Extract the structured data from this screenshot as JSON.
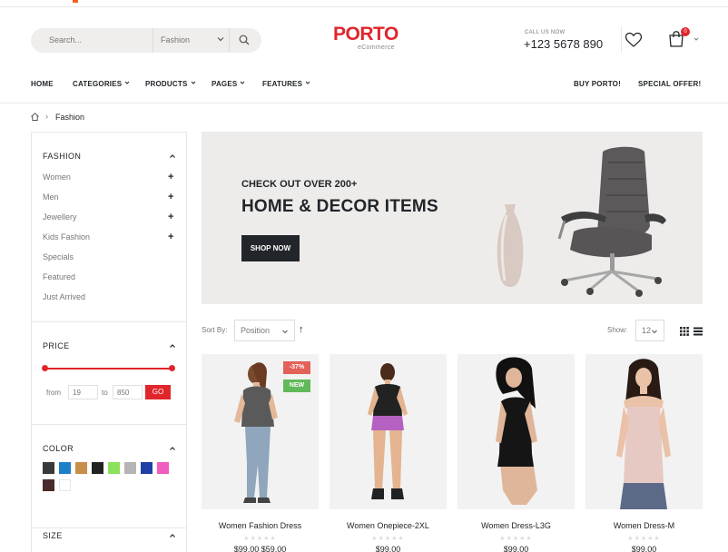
{
  "header": {
    "search_placeholder": "Search...",
    "category_select": "Fashion",
    "logo_text": "PORTO",
    "logo_sub": "eCommerce",
    "call_label": "CALL US NOW",
    "phone": "+123 5678 890",
    "cart_count": "0",
    "brand_color": "#e0262c"
  },
  "nav": {
    "items": [
      {
        "label": "HOME"
      },
      {
        "label": "CATEGORIES"
      },
      {
        "label": "PRODUCTS"
      },
      {
        "label": "PAGES"
      },
      {
        "label": "FEATURES"
      }
    ],
    "right": [
      {
        "label": "BUY PORTO!"
      },
      {
        "label": "SPECIAL OFFER!"
      }
    ]
  },
  "breadcrumb": {
    "current": "Fashion",
    "separator": "›"
  },
  "sidebar": {
    "fashion": {
      "title": "FASHION",
      "items": [
        {
          "label": "Women",
          "expandable": "+"
        },
        {
          "label": "Men",
          "expandable": "+"
        },
        {
          "label": "Jewellery",
          "expandable": "+"
        },
        {
          "label": "Kids Fashion",
          "expandable": "+"
        },
        {
          "label": "Specials"
        },
        {
          "label": "Featured"
        },
        {
          "label": "Just Arrived"
        }
      ]
    },
    "price": {
      "title": "PRICE",
      "from_label": "from",
      "to_label": "to",
      "min": "19",
      "max": "850",
      "go_label": "GO"
    },
    "color": {
      "title": "COLOR",
      "swatches": [
        "#3a3a3a",
        "#1e7fc9",
        "#c98e4a",
        "#222222",
        "#8be05c",
        "#b5b5b5",
        "#1f3ea8",
        "#f25bbf",
        "#4a2b2b",
        "#ffffff"
      ]
    },
    "size": {
      "title": "SIZE"
    }
  },
  "banner": {
    "line1": "CHECK OUT OVER 200+",
    "line2": "HOME & DECOR ITEMS",
    "button": "SHOP NOW"
  },
  "toolbar": {
    "sort_label": "Sort By:",
    "sort_value": "Position",
    "sort_arrow": "↑",
    "show_label": "Show:",
    "show_value": "12"
  },
  "products": [
    {
      "name": "Women Fashion Dress",
      "badges": [
        "-37%",
        "NEW"
      ],
      "stars": "★★★★★",
      "price": "$99.00 $59.00"
    },
    {
      "name": "Women Onepiece-2XL",
      "stars": "★★★★★",
      "price": "$99.00"
    },
    {
      "name": "Women Dress-L3G",
      "stars": "★★★★★",
      "price": "$99.00"
    },
    {
      "name": "Women Dress-M",
      "stars": "★★★★★",
      "price": "$99.00"
    }
  ]
}
